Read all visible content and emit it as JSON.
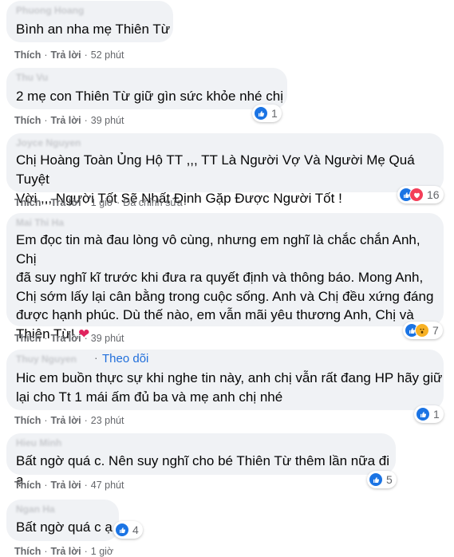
{
  "comments": [
    {
      "author": "Phuong Hoang",
      "text": "Bình an nha mẹ Thiên Từ",
      "like": "Thích",
      "reply": "Trả lời",
      "time": "52 phút"
    },
    {
      "author": "Thu Vu",
      "text": "2 mẹ con Thiên Từ giữ gìn sức khỏe nhé chị",
      "like": "Thích",
      "reply": "Trả lời",
      "time": "39 phút",
      "reactions": [
        "like-icon"
      ],
      "reaction_count": "1"
    },
    {
      "author": "Joyce Nguyen",
      "text_lines": [
        "Chị Hoàng Toàn Ủng Hộ TT ,,, TT Là Người Vợ Và Người Mẹ Quá Tuyệt",
        "Vời ,,, Người Tốt Sẽ Nhất Định Gặp Được Người Tốt !"
      ],
      "like": "Thích",
      "reply": "Trả lời",
      "time": "1 giờ",
      "edited": "Đã chỉnh sửa",
      "reactions": [
        "like-icon",
        "love-icon"
      ],
      "reaction_count": "16"
    },
    {
      "author": "Mai Thi Ha",
      "text_lines": [
        "Em đọc tin mà đau lòng vô cùng, nhưng em nghĩ là chắc chắn Anh, Chị",
        "đã suy nghĩ kĩ trước khi đưa ra quyết định và thông báo. Mong Anh,",
        "Chị sớm lấy lại cân bằng trong cuộc sống. Anh và Chị đều xứng đáng",
        "được hạnh phúc. Dù thế nào, em vẫn mãi yêu thương Anh, Chị và",
        "Thiên Từ!"
      ],
      "emoji": "❤",
      "like": "Thích",
      "reply": "Trả lời",
      "time": "39 phút",
      "reactions": [
        "like-icon",
        "wow-icon"
      ],
      "reaction_count": "7"
    },
    {
      "author": "Thuy Nguyen",
      "follow_dot": "·",
      "follow": "Theo dõi",
      "text_lines": [
        "Hic em buồn thực sự khi nghe tin này, anh chị vẫn rất đang HP hãy giữ",
        "lại cho Tt 1 mái ấm đủ ba và mẹ anh chị nhé"
      ],
      "like": "Thích",
      "reply": "Trả lời",
      "time": "23 phút",
      "reactions": [
        "like-icon"
      ],
      "reaction_count": "1"
    },
    {
      "author": "Hieu Minh",
      "text": "Bất ngờ quá c. Nên suy nghĩ cho bé Thiên Từ thêm lần nữa đi ạ",
      "like": "Thích",
      "reply": "Trả lời",
      "time": "47 phút",
      "reactions": [
        "like-icon"
      ],
      "reaction_count": "5"
    },
    {
      "author": "Ngan Ha",
      "text": "Bất ngờ quá c ạ.",
      "like": "Thích",
      "reply": "Trả lời",
      "time": "1 giờ",
      "reactions": [
        "like-icon"
      ],
      "reaction_count": "4"
    }
  ],
  "colors": {
    "bubble": "#f0f2f5",
    "like": "#1b74e4",
    "love": "#f33e58",
    "wow": "#f7b125",
    "link": "#216fdb",
    "meta": "#65676b"
  }
}
